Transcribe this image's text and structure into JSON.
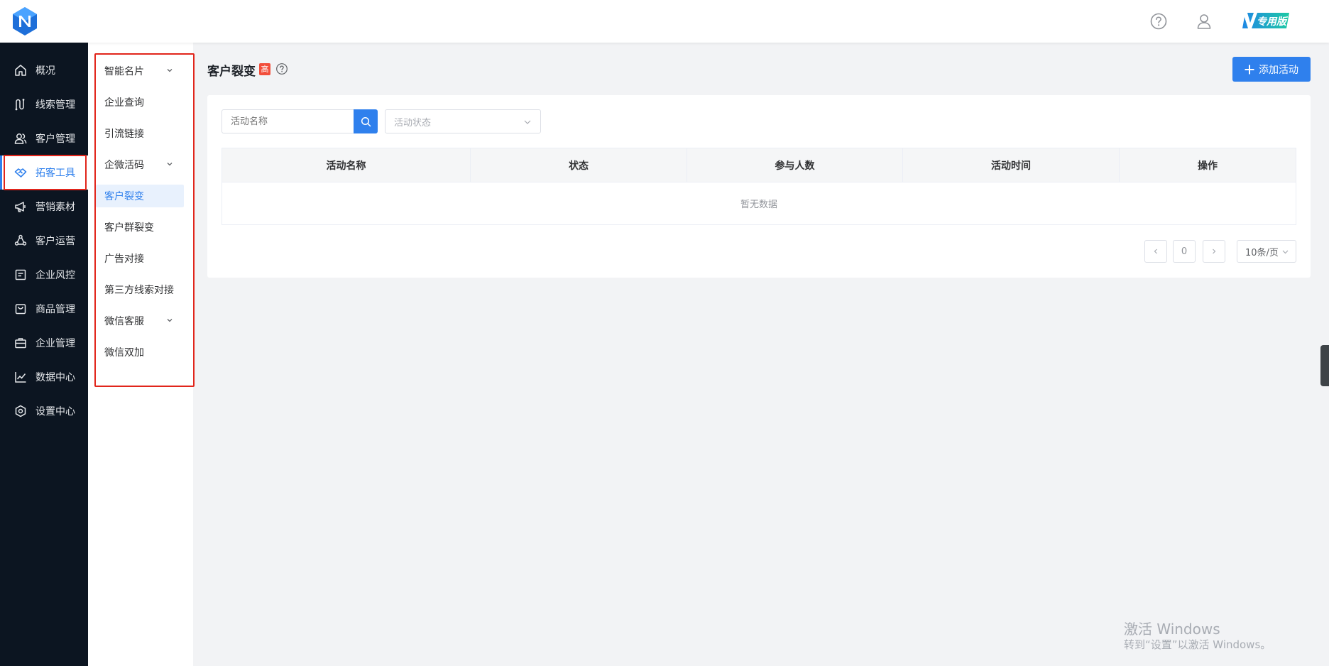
{
  "header": {
    "edition_label": "专用版"
  },
  "nav": {
    "items": [
      {
        "label": "概况",
        "icon": "home-icon"
      },
      {
        "label": "线索管理",
        "icon": "route-icon"
      },
      {
        "label": "客户管理",
        "icon": "users-icon"
      },
      {
        "label": "拓客工具",
        "icon": "handshake-icon",
        "active": true
      },
      {
        "label": "营销素材",
        "icon": "megaphone-icon"
      },
      {
        "label": "客户运营",
        "icon": "share-nodes-icon"
      },
      {
        "label": "企业风控",
        "icon": "document-icon"
      },
      {
        "label": "商品管理",
        "icon": "shopping-bag-icon"
      },
      {
        "label": "企业管理",
        "icon": "briefcase-icon"
      },
      {
        "label": "数据中心",
        "icon": "line-chart-icon"
      },
      {
        "label": "设置中心",
        "icon": "settings-hexagon-icon"
      }
    ]
  },
  "submenu": {
    "items": [
      {
        "label": "智能名片",
        "expandable": true
      },
      {
        "label": "企业查询"
      },
      {
        "label": "引流链接"
      },
      {
        "label": "企微活码",
        "expandable": true
      },
      {
        "label": "客户裂变",
        "active": true
      },
      {
        "label": "客户群裂变"
      },
      {
        "label": "广告对接"
      },
      {
        "label": "第三方线索对接"
      },
      {
        "label": "微信客服",
        "expandable": true
      },
      {
        "label": "微信双加"
      }
    ]
  },
  "main": {
    "title": "客户裂变",
    "level_badge": "高",
    "add_button": "添加活动",
    "search_placeholder": "活动名称",
    "status_placeholder": "活动状态",
    "table": {
      "columns": [
        "活动名称",
        "状态",
        "参与人数",
        "活动时间",
        "操作"
      ],
      "empty_text": "暂无数据"
    },
    "pagination": {
      "current_page": "0",
      "page_size": "10条/页"
    }
  },
  "watermark": {
    "line1": "激活 Windows",
    "line2": "转到“设置”以激活 Windows。"
  },
  "colors": {
    "accent": "#2f80ed",
    "nav_bg": "#0c1521",
    "highlight_box": "#e1251b",
    "badge": "#f24e3b"
  }
}
